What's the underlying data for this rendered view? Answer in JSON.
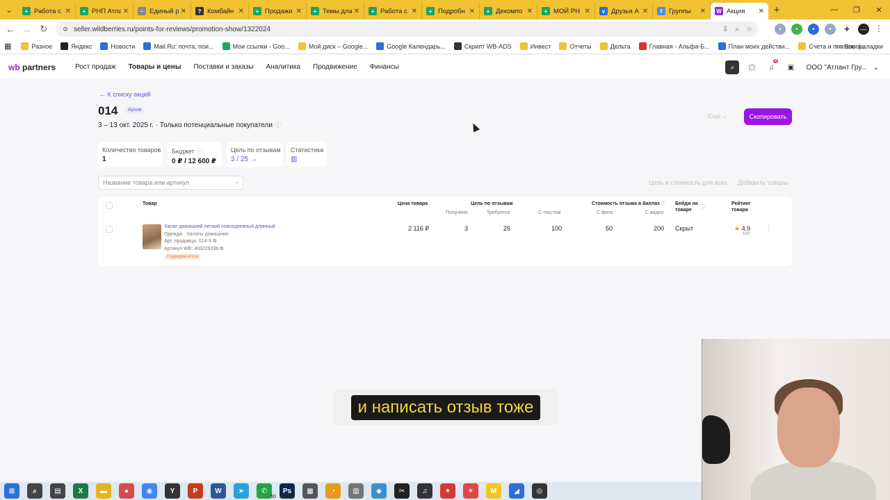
{
  "browser": {
    "tabs": [
      {
        "title": "Работа с",
        "color": "#1fa463",
        "glyph": "+"
      },
      {
        "title": "РНП Атла",
        "color": "#1fa463",
        "glyph": "+"
      },
      {
        "title": "Единый р",
        "color": "#888888",
        "glyph": "~"
      },
      {
        "title": "Комбайн",
        "color": "#333333",
        "glyph": "?"
      },
      {
        "title": "Продажи",
        "color": "#1fa463",
        "glyph": "+"
      },
      {
        "title": "Темы дла",
        "color": "#1fa463",
        "glyph": "+"
      },
      {
        "title": "Работа с",
        "color": "#1fa463",
        "glyph": "+"
      },
      {
        "title": "Подробн",
        "color": "#1fa463",
        "glyph": "+"
      },
      {
        "title": "Декомпо",
        "color": "#1fa463",
        "glyph": "+"
      },
      {
        "title": "МОЙ РН",
        "color": "#1fa463",
        "glyph": "+"
      },
      {
        "title": "Друзья А",
        "color": "#2c6eda",
        "glyph": "v"
      },
      {
        "title": "Группы",
        "color": "#4a90d9",
        "glyph": "f"
      },
      {
        "title": "Акция",
        "color": "#8a2be2",
        "glyph": "W"
      }
    ],
    "url": "seller.wildberries.ru/points-for-reviews/promotion-show/1322024",
    "bookmarks": [
      {
        "label": "Разное",
        "color": "#f1c232"
      },
      {
        "label": "Яндекс",
        "color": "#222222"
      },
      {
        "label": "Новости",
        "color": "#2c6eda"
      },
      {
        "label": "Mail.Ru: почта, пои...",
        "color": "#2c6eda"
      },
      {
        "label": "Мои ссылки - Goo...",
        "color": "#1fa463"
      },
      {
        "label": "Мой диск – Google...",
        "color": "#f1c232"
      },
      {
        "label": "Google Календарь...",
        "color": "#2c6eda"
      },
      {
        "label": "Скрипт WB-ADS",
        "color": "#333333"
      },
      {
        "label": "Инвест",
        "color": "#f1c232"
      },
      {
        "label": "Отчеты",
        "color": "#f1c232"
      },
      {
        "label": "Дельта",
        "color": "#f1c232"
      },
      {
        "label": "Главная - Альфа-Б...",
        "color": "#e03030"
      },
      {
        "label": "План моих действи...",
        "color": "#2c6eda"
      },
      {
        "label": "Счета и платежи |...",
        "color": "#f1c232"
      }
    ],
    "all_bookmarks": "Все закладки"
  },
  "header": {
    "logo_wb": "wb",
    "logo_partners": "partners",
    "nav": [
      "Рост продаж",
      "Товары и цены",
      "Поставки и заказы",
      "Аналитика",
      "Продвижение",
      "Финансы"
    ],
    "company": "ООО \"Атлант Гру...",
    "notif_count": "8"
  },
  "promo": {
    "back": "К списку акций",
    "title": "014",
    "badge": "Архив",
    "subtitle": "3 – 13 окт. 2025 г. · Только потенциальные покупатели",
    "more": "Еще",
    "copy": "Скопировать"
  },
  "metrics": [
    {
      "label": "Количество товаров",
      "value": "1"
    },
    {
      "label": "Бюджет",
      "value": "0 ₽ / 12 600 ₽"
    },
    {
      "label": "Цель по отзывам",
      "value": "3 / 25 →"
    },
    {
      "label": "Статистика",
      "value": ""
    }
  ],
  "search": {
    "placeholder": "Название товара или артикул"
  },
  "actions": {
    "goal_all": "Цель и стоимость для всех",
    "add": "Добавить товары"
  },
  "table": {
    "headers": {
      "product": "Товар",
      "price": "Цена товара",
      "goal": "Цель по отзывам",
      "received": "Получено",
      "required": "Требуется",
      "with_text": "С текстом",
      "cost": "Стоимость отзыва в баллах",
      "with_photo": "С фото",
      "with_video": "С видео",
      "badge": "Бейдж на товаре",
      "rating": "Рейтинг товара"
    },
    "row": {
      "name": "Халат домашний летний повседневный длинный",
      "category": "Одежда · Халаты домашние",
      "seller_art": "Арт. продавца: 014-Х",
      "wb_art": "Артикул WB: 403229338",
      "tag": "Подводим итоги",
      "price": "2 116 ₽",
      "received": "3",
      "required": "25",
      "with_text": "100",
      "with_photo": "50",
      "with_video": "200",
      "badge": "Скрыт",
      "rating": "4.9",
      "rating_count": "109"
    }
  },
  "caption": "и написать отзыв тоже",
  "taskbar": {
    "apps": [
      {
        "name": "windows-start",
        "color": "#2c6eda",
        "glyph": "⊞"
      },
      {
        "name": "search",
        "color": "#444444",
        "glyph": "⌕"
      },
      {
        "name": "task-view",
        "color": "#444444",
        "glyph": "▤"
      },
      {
        "name": "excel",
        "color": "#1d7a45",
        "glyph": "X"
      },
      {
        "name": "file-explorer",
        "color": "#e6b422",
        "glyph": "▬"
      },
      {
        "name": "app-colorful",
        "color": "#d64b4b",
        "glyph": "●"
      },
      {
        "name": "chrome",
        "color": "#4285f4",
        "glyph": "◉"
      },
      {
        "name": "yandex",
        "color": "#333333",
        "glyph": "Y"
      },
      {
        "name": "powerpoint",
        "color": "#c43e1c",
        "glyph": "P"
      },
      {
        "name": "word",
        "color": "#2b579a",
        "glyph": "W"
      },
      {
        "name": "telegram",
        "color": "#2aa1da",
        "glyph": "➤"
      },
      {
        "name": "whatsapp",
        "color": "#25a244",
        "glyph": "✆",
        "badge": "50"
      },
      {
        "name": "photoshop",
        "color": "#0e2a47",
        "glyph": "Ps"
      },
      {
        "name": "calculator",
        "color": "#555555",
        "glyph": "▦"
      },
      {
        "name": "app-orange",
        "color": "#e89a1a",
        "glyph": "◔"
      },
      {
        "name": "app-gray",
        "color": "#777777",
        "glyph": "▥"
      },
      {
        "name": "app-blue",
        "color": "#3a8fd4",
        "glyph": "◆"
      },
      {
        "name": "capcut",
        "color": "#222222",
        "glyph": "✂"
      },
      {
        "name": "music",
        "color": "#333333",
        "glyph": "♫"
      },
      {
        "name": "app-red",
        "color": "#d43a3a",
        "glyph": "✦"
      },
      {
        "name": "app-red2",
        "color": "#e04646",
        "glyph": "✶"
      },
      {
        "name": "miro",
        "color": "#f6c524",
        "glyph": "M"
      },
      {
        "name": "app-edge",
        "color": "#2b6fd6",
        "glyph": "◢"
      },
      {
        "name": "obs",
        "color": "#333333",
        "glyph": "◎"
      }
    ]
  }
}
